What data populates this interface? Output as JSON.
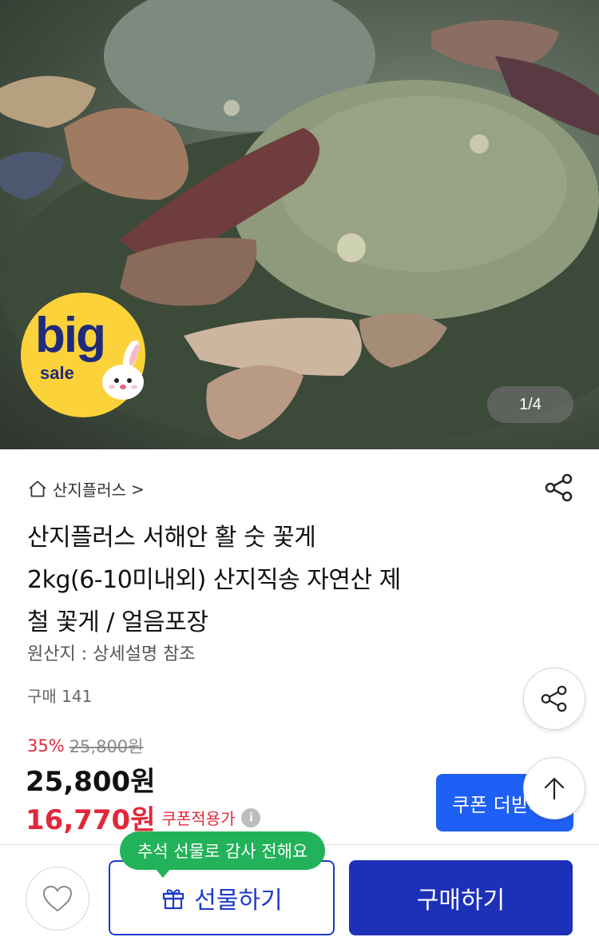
{
  "hero": {
    "image_alt": "꽃게",
    "page_counter": "1/4",
    "badge_top": "big",
    "badge_bottom": "sale"
  },
  "product": {
    "store_name": "산지플러스",
    "store_chevron": ">",
    "title_lines": [
      "산지플러스 서해안 활 숫 꽃게",
      "2kg(6-10미내외) 산지직송 자연산 제",
      "철 꽃게 / 얼음포장"
    ],
    "origin": "원산지 : 상세설명 참조",
    "purchase_count": "구매 141",
    "discount_rate": "35%",
    "original_price": "25,800원",
    "price": "25,800원",
    "coupon_price": "16,770원",
    "coupon_label": "쿠폰적용가",
    "info_icon": "i"
  },
  "coupon_button": {
    "label": "쿠폰 더받기"
  },
  "bottom_bar": {
    "tooltip": "추석 선물로 감사 전해요",
    "gift_label": "선물하기",
    "buy_label": "구매하기"
  },
  "icons": {
    "home": "home-icon",
    "share": "share-icon",
    "arrow_up": "arrow-up-icon",
    "heart": "heart-icon",
    "gift": "gift-icon"
  },
  "colors": {
    "accent_blue": "#1e5ff5",
    "buy_navy": "#1c30b8",
    "discount_red": "#e0283a",
    "tooltip_green": "#22b35a",
    "badge_yellow": "#fbd23a"
  }
}
